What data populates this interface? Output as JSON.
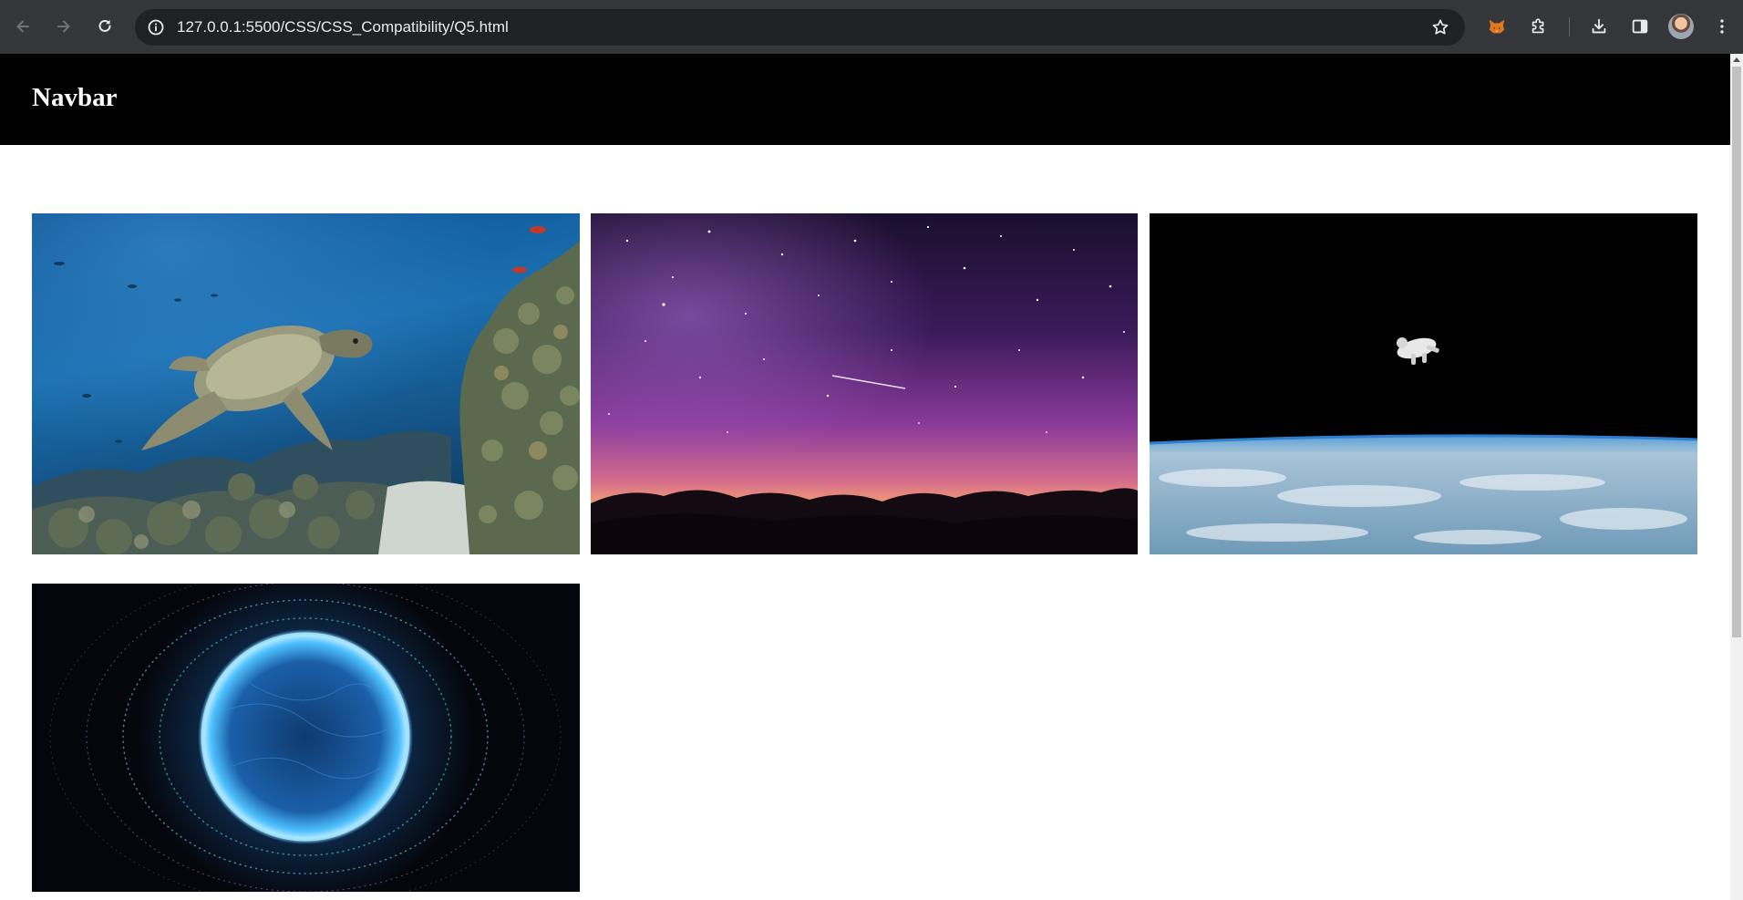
{
  "browser": {
    "url": "127.0.0.1:5500/CSS/CSS_Compatibility/Q5.html",
    "icons": {
      "back": "arrow-left-icon",
      "forward": "arrow-right-icon",
      "reload": "reload-icon",
      "site_info": "info-circle-icon",
      "bookmark": "star-icon",
      "metamask": "fox-icon",
      "extensions": "puzzle-icon",
      "downloads": "download-icon",
      "side_panel": "side-panel-icon",
      "profile": "avatar",
      "menu": "kebab-menu-icon"
    },
    "colors": {
      "toolbar": "#35363a",
      "omnibox": "#202124",
      "text": "#e8eaed"
    }
  },
  "page": {
    "navbar": {
      "title": "Navbar",
      "background": "#000000",
      "text_color": "#ffffff"
    },
    "gallery": [
      {
        "name": "sea-turtle-reef-image"
      },
      {
        "name": "milky-way-night-sky-image"
      },
      {
        "name": "astronaut-over-earth-image"
      },
      {
        "name": "glowing-particle-sphere-image"
      }
    ]
  }
}
